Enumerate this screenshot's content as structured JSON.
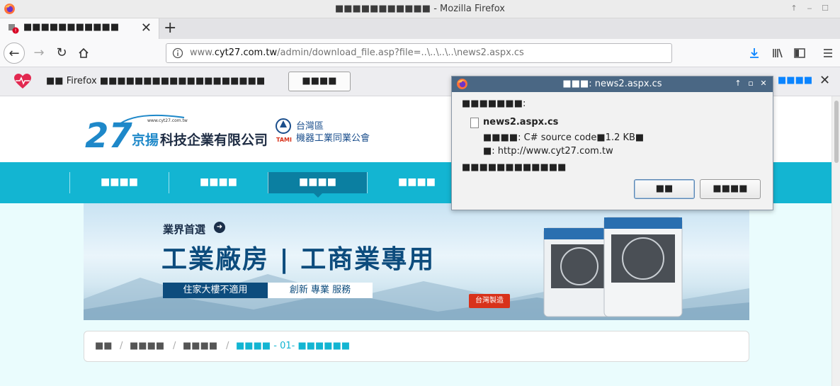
{
  "window": {
    "title": "■■■■■■■■■■■ - Mozilla Firefox"
  },
  "tab": {
    "title": "■■■■■■■■■■■",
    "close": "✕",
    "new_tab": "+"
  },
  "nav": {
    "url_prefix": "www.",
    "url_domain": "cyt27.com.tw",
    "url_path": "/admin/download_file.asp?file=..\\..\\..\\..\\news2.aspx.cs"
  },
  "notification": {
    "text": "■■ Firefox ■■■■■■■■■■■■■■■■■■■",
    "button": "■■■■",
    "link": "■■■■",
    "close": "✕"
  },
  "site": {
    "menu": [
      "■■■■",
      "■■■■",
      "■■■■",
      "■■■■"
    ],
    "banner": {
      "tagline": "業界首選",
      "headline": "工業廠房 | 工商業專用",
      "sub_left": "住家大樓不適用",
      "sub_right": "創新  專業  服務",
      "badge": "台灣製造"
    },
    "breadcrumb": {
      "items": [
        "■■",
        "■■■■",
        "■■■■"
      ],
      "current": "■■■■ - 01- ■■■■■■"
    }
  },
  "dialog": {
    "title": "■■■: news2.aspx.cs",
    "label": "■■■■■■■:",
    "file_name": "news2.aspx.cs",
    "file_type": "■■■■: C# source code■1.2 KB■",
    "file_from": "■: http://www.cyt27.com.tw",
    "question": "■■■■■■■■■■■■",
    "ok": "■■",
    "cancel": "■■■■"
  }
}
